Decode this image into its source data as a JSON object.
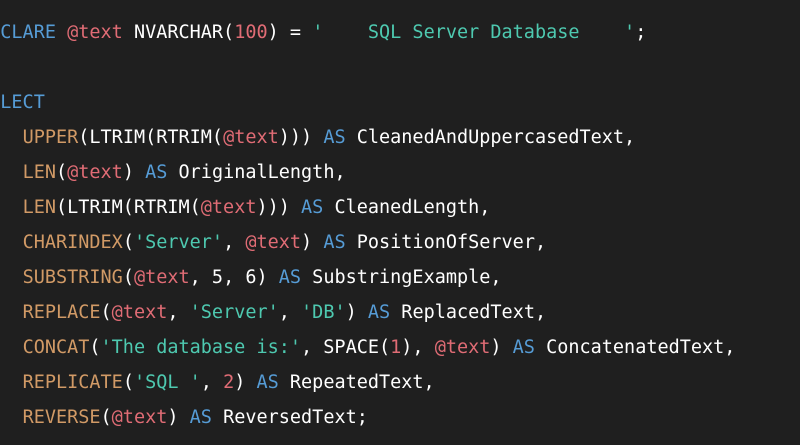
{
  "theme": {
    "background": "#1f1f1f",
    "keyword_color": "#569cd6",
    "variable_color": "#e06c75",
    "function_color": "#d19a66",
    "string_color": "#4ec9b0",
    "plain_color": "#ffffff"
  },
  "code": {
    "lines": [
      [
        {
          "t": "DECLARE ",
          "c": "kw"
        },
        {
          "t": "@text",
          "c": "var"
        },
        {
          "t": " NVARCHAR(",
          "c": "id"
        },
        {
          "t": "100",
          "c": "num"
        },
        {
          "t": ") = ",
          "c": "pl"
        },
        {
          "t": "'    SQL Server Database    '",
          "c": "str"
        },
        {
          "t": ";",
          "c": "pl"
        }
      ],
      [],
      [
        {
          "t": "SELECT",
          "c": "kw"
        }
      ],
      [
        {
          "t": "    ",
          "c": "pl"
        },
        {
          "t": "UPPER",
          "c": "fn"
        },
        {
          "t": "(LTRIM(RTRIM(",
          "c": "pl"
        },
        {
          "t": "@text",
          "c": "var"
        },
        {
          "t": "))) ",
          "c": "pl"
        },
        {
          "t": "AS",
          "c": "kw"
        },
        {
          "t": " CleanedAndUppercasedText,",
          "c": "id"
        }
      ],
      [
        {
          "t": "    ",
          "c": "pl"
        },
        {
          "t": "LEN",
          "c": "fn"
        },
        {
          "t": "(",
          "c": "pl"
        },
        {
          "t": "@text",
          "c": "var"
        },
        {
          "t": ") ",
          "c": "pl"
        },
        {
          "t": "AS",
          "c": "kw"
        },
        {
          "t": " OriginalLength,",
          "c": "id"
        }
      ],
      [
        {
          "t": "    ",
          "c": "pl"
        },
        {
          "t": "LEN",
          "c": "fn"
        },
        {
          "t": "(LTRIM(RTRIM(",
          "c": "pl"
        },
        {
          "t": "@text",
          "c": "var"
        },
        {
          "t": "))) ",
          "c": "pl"
        },
        {
          "t": "AS",
          "c": "kw"
        },
        {
          "t": " CleanedLength,",
          "c": "id"
        }
      ],
      [
        {
          "t": "    ",
          "c": "pl"
        },
        {
          "t": "CHARINDEX",
          "c": "fn"
        },
        {
          "t": "(",
          "c": "pl"
        },
        {
          "t": "'Server'",
          "c": "str"
        },
        {
          "t": ", ",
          "c": "pl"
        },
        {
          "t": "@text",
          "c": "var"
        },
        {
          "t": ") ",
          "c": "pl"
        },
        {
          "t": "AS",
          "c": "kw"
        },
        {
          "t": " PositionOfServer,",
          "c": "id"
        }
      ],
      [
        {
          "t": "    ",
          "c": "pl"
        },
        {
          "t": "SUBSTRING",
          "c": "fn"
        },
        {
          "t": "(",
          "c": "pl"
        },
        {
          "t": "@text",
          "c": "var"
        },
        {
          "t": ", 5, 6) ",
          "c": "pl"
        },
        {
          "t": "AS",
          "c": "kw"
        },
        {
          "t": " SubstringExample,",
          "c": "id"
        }
      ],
      [
        {
          "t": "    ",
          "c": "pl"
        },
        {
          "t": "REPLACE",
          "c": "fn"
        },
        {
          "t": "(",
          "c": "pl"
        },
        {
          "t": "@text",
          "c": "var"
        },
        {
          "t": ", ",
          "c": "pl"
        },
        {
          "t": "'Server'",
          "c": "str"
        },
        {
          "t": ", ",
          "c": "pl"
        },
        {
          "t": "'DB'",
          "c": "str"
        },
        {
          "t": ") ",
          "c": "pl"
        },
        {
          "t": "AS",
          "c": "kw"
        },
        {
          "t": " ReplacedText,",
          "c": "id"
        }
      ],
      [
        {
          "t": "    ",
          "c": "pl"
        },
        {
          "t": "CONCAT",
          "c": "fn"
        },
        {
          "t": "(",
          "c": "pl"
        },
        {
          "t": "'The database is:'",
          "c": "str"
        },
        {
          "t": ", SPACE(",
          "c": "pl"
        },
        {
          "t": "1",
          "c": "num"
        },
        {
          "t": "), ",
          "c": "pl"
        },
        {
          "t": "@text",
          "c": "var"
        },
        {
          "t": ") ",
          "c": "pl"
        },
        {
          "t": "AS",
          "c": "kw"
        },
        {
          "t": " ConcatenatedText,",
          "c": "id"
        }
      ],
      [
        {
          "t": "    ",
          "c": "pl"
        },
        {
          "t": "REPLICATE",
          "c": "fn"
        },
        {
          "t": "(",
          "c": "pl"
        },
        {
          "t": "'SQL '",
          "c": "str"
        },
        {
          "t": ", ",
          "c": "pl"
        },
        {
          "t": "2",
          "c": "num"
        },
        {
          "t": ") ",
          "c": "pl"
        },
        {
          "t": "AS",
          "c": "kw"
        },
        {
          "t": " RepeatedText,",
          "c": "id"
        }
      ],
      [
        {
          "t": "    ",
          "c": "pl"
        },
        {
          "t": "REVERSE",
          "c": "fn"
        },
        {
          "t": "(",
          "c": "pl"
        },
        {
          "t": "@text",
          "c": "var"
        },
        {
          "t": ") ",
          "c": "pl"
        },
        {
          "t": "AS",
          "c": "kw"
        },
        {
          "t": " ReversedText;",
          "c": "id"
        }
      ]
    ]
  }
}
